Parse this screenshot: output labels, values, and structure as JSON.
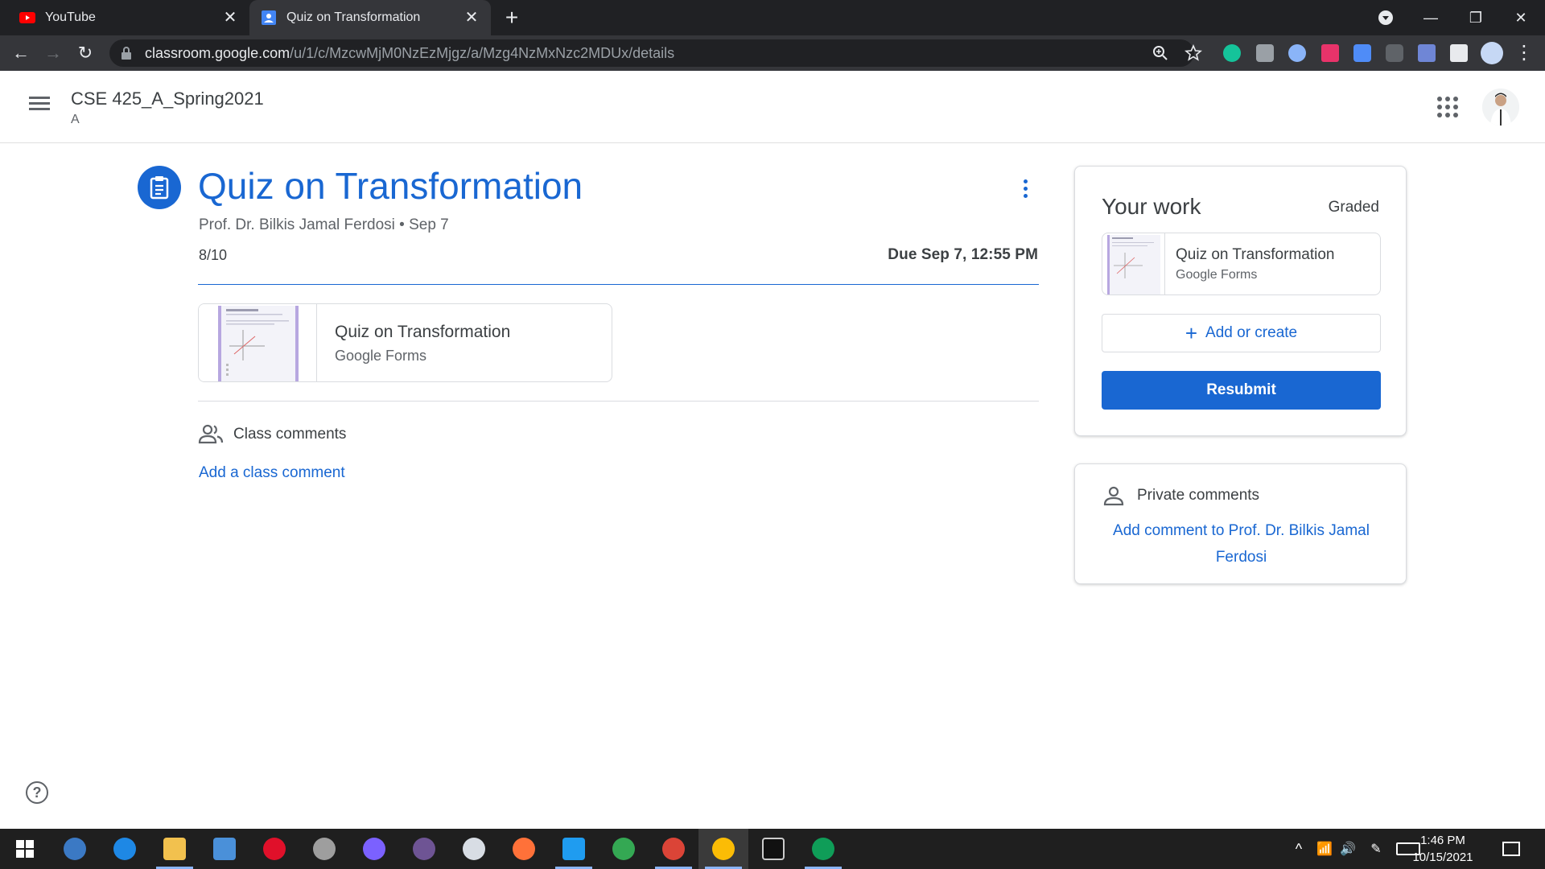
{
  "browser": {
    "tabs": [
      {
        "title": "YouTube",
        "active": false
      },
      {
        "title": "Quiz on Transformation",
        "active": true
      }
    ],
    "url_host": "classroom.google.com",
    "url_path": "/u/1/c/MzcwMjM0NzEzMjgz/a/Mzg4NzMxNzc2MDUx/details"
  },
  "header": {
    "class_title": "CSE 425_A_Spring2021",
    "class_section": "A"
  },
  "assignment": {
    "title": "Quiz on Transformation",
    "meta": "Prof. Dr. Bilkis Jamal Ferdosi • Sep 7",
    "grade": "8/10",
    "due": "Due Sep 7, 12:55 PM",
    "attachment": {
      "title": "Quiz on Transformation",
      "type": "Google Forms"
    }
  },
  "class_comments": {
    "label": "Class comments",
    "add_link": "Add a class comment"
  },
  "your_work": {
    "title": "Your work",
    "status": "Graded",
    "attachment": {
      "title": "Quiz on Transformation",
      "type": "Google Forms"
    },
    "add_or_create": "Add or create",
    "resubmit": "Resubmit"
  },
  "private_comments": {
    "label": "Private comments",
    "add_link": "Add comment to Prof. Dr. Bilkis Jamal Ferdosi"
  },
  "taskbar": {
    "time": "1:46 PM",
    "date": "10/15/2021"
  },
  "colors": {
    "accent": "#1967d2",
    "chrome_dark": "#202124"
  }
}
